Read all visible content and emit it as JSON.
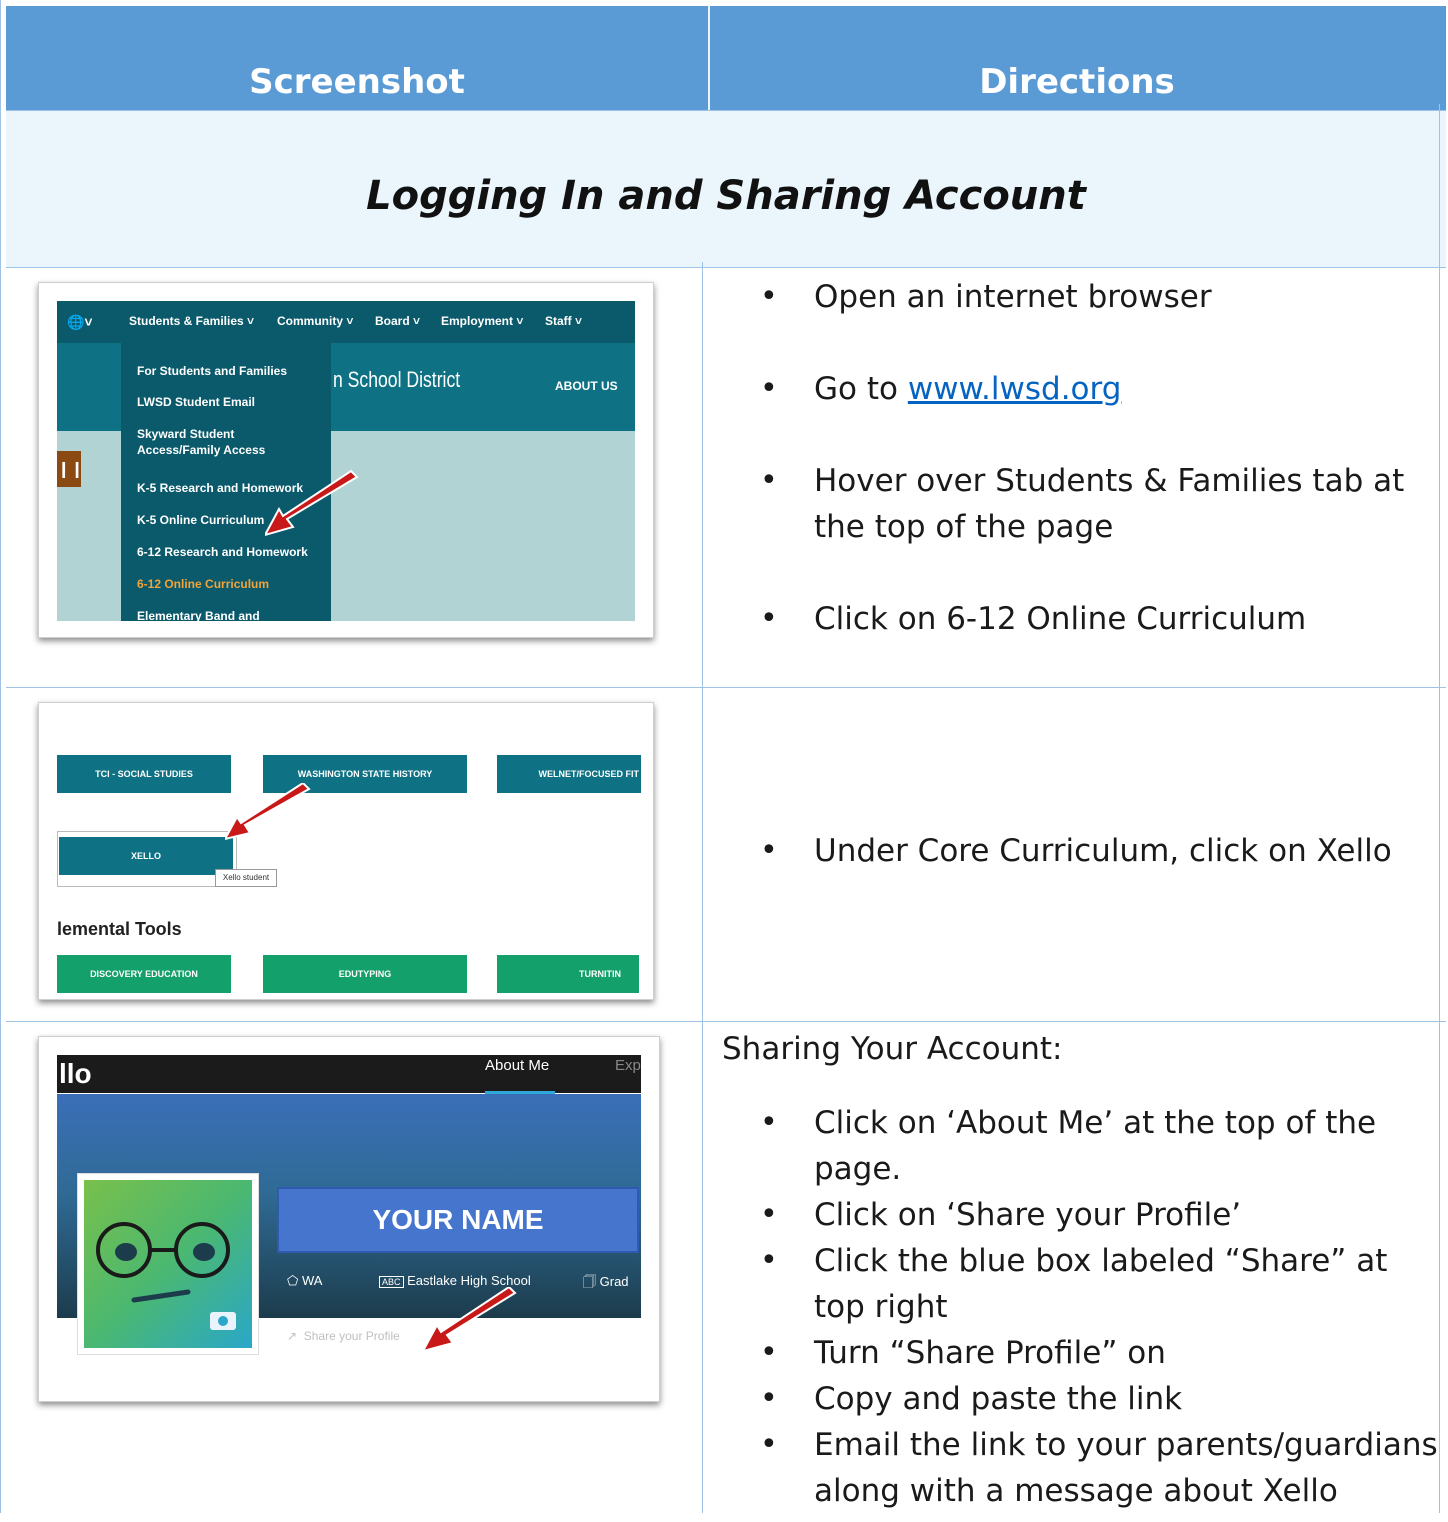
{
  "header": {
    "left": "Screenshot",
    "right": "Directions"
  },
  "section_title": "Logging In and Sharing Account",
  "rows": [
    {
      "directions": [
        "Open an internet browser",
        "Go to ",
        "Hover over Students & Families tab at the top of the page",
        "Click on 6-12 Online Curriculum"
      ],
      "link_text": "www.lwsd.org",
      "screenshot": {
        "nav": [
          "Students & Families ˅",
          "Community ˅",
          "Board ˅",
          "Employment ˅",
          "Staff ˅"
        ],
        "district": "n School District",
        "about": "ABOUT US",
        "menu": [
          "For Students and Families",
          "LWSD Student Email",
          "Skyward Student Access/Family Access",
          "K-5 Research and Homework",
          "K-5 Online Curriculum",
          "6-12 Research and Homework",
          "6-12 Online Curriculum",
          "Elementary Band and"
        ],
        "highlight_color": "#f2a33a"
      }
    },
    {
      "directions": [
        "Under Core Curriculum, click on Xello"
      ],
      "screenshot": {
        "top_buttons": [
          "TCI - SOCIAL STUDIES",
          "WASHINGTON STATE HISTORY",
          "WELNET/FOCUSED FIT"
        ],
        "xello": "XELLO",
        "tooltip": "Xello student",
        "section": "lemental Tools",
        "bottom_buttons": [
          "DISCOVERY EDUCATION",
          "EDUTYPING",
          "TURNITIN"
        ]
      }
    },
    {
      "intro": "Sharing Your Account:",
      "directions": [
        "Click on ‘About Me’ at the top of the page.",
        "Click on ‘Share your Profile’",
        "Click the blue box labeled “Share” at top right",
        "Turn “Share Profile” on",
        "Copy and paste the link",
        "Email the link to your parents/guardians along with a message about Xello"
      ],
      "screenshot": {
        "logo": "llo",
        "nav_about": "About Me",
        "nav_next": "Exp",
        "name": "YOUR NAME",
        "state": "WA",
        "school": "Eastlake High School",
        "grade": "Grad",
        "share": "Share your Profile"
      }
    }
  ]
}
